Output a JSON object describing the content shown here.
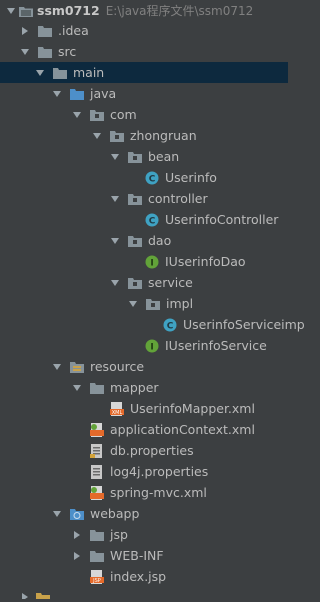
{
  "project": {
    "name": "ssm0712",
    "path": "E:\\java程序文件\\ssm0712"
  },
  "nodes": {
    "idea": ".idea",
    "src": "src",
    "main": "main",
    "java": "java",
    "com": "com",
    "zhongruan": "zhongruan",
    "bean": "bean",
    "userinfo": "Userinfo",
    "controller": "controller",
    "userinfo_controller": "UserinfoController",
    "dao": "dao",
    "iuserinfo_dao": "IUserinfoDao",
    "service": "service",
    "impl": "impl",
    "userinfo_service_impl": "UserinfoServiceimp",
    "iuserinfo_service": "IUserinfoService",
    "resource": "resource",
    "mapper": "mapper",
    "userinfo_mapper_xml": "UserinfoMapper.xml",
    "application_context_xml": "applicationContext.xml",
    "db_properties": "db.properties",
    "log4j_properties": "log4j.properties",
    "spring_mvc_xml": "spring-mvc.xml",
    "webapp": "webapp",
    "jsp": "jsp",
    "web_inf": "WEB-INF",
    "index_jsp": "index.jsp"
  },
  "colors": {
    "background": "#3c3f41",
    "selection": "#0d293e",
    "folder": "#87939a",
    "source_folder": "#4d8fc9",
    "class_icon": "#3fa2c3",
    "interface_icon": "#62a339",
    "xml_icon": "#e46a2b"
  },
  "icons": {
    "folder": "folder-icon",
    "class": "class-icon",
    "interface": "interface-icon",
    "xml": "xml-file-icon",
    "properties": "properties-file-icon",
    "jsp": "jsp-file-icon"
  }
}
